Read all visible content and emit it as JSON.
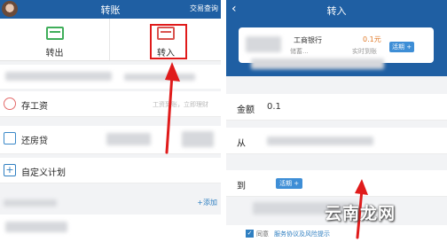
{
  "left": {
    "header": {
      "title": "转账",
      "query": "交易查询"
    },
    "tabs": [
      {
        "label": "转出"
      },
      {
        "label": "转入"
      }
    ],
    "rows": [
      {
        "label": "存工资",
        "hint": "工资到账，立即理财"
      },
      {
        "label": "还房贷"
      },
      {
        "label": "自定义计划"
      }
    ],
    "add_label": "+添加"
  },
  "right": {
    "header": {
      "title": "转入",
      "back": "‹"
    },
    "card": {
      "bank": "工商银行",
      "amount": "0.1元",
      "sub1": "储蓄...",
      "sub2": "实时到账",
      "tag": "活期 +"
    },
    "fields": [
      {
        "label": "金额",
        "value": "0.1"
      },
      {
        "label": "从",
        "value": ""
      },
      {
        "label": "到",
        "tag": "活期 +"
      }
    ],
    "agree": {
      "prefix": "同意",
      "link": "服务协议及风险提示"
    }
  },
  "watermark": "云南龙网",
  "colors": {
    "brand": "#1f5fa3",
    "highlight": "#e01b1b",
    "tag": "#3e8ed6"
  }
}
